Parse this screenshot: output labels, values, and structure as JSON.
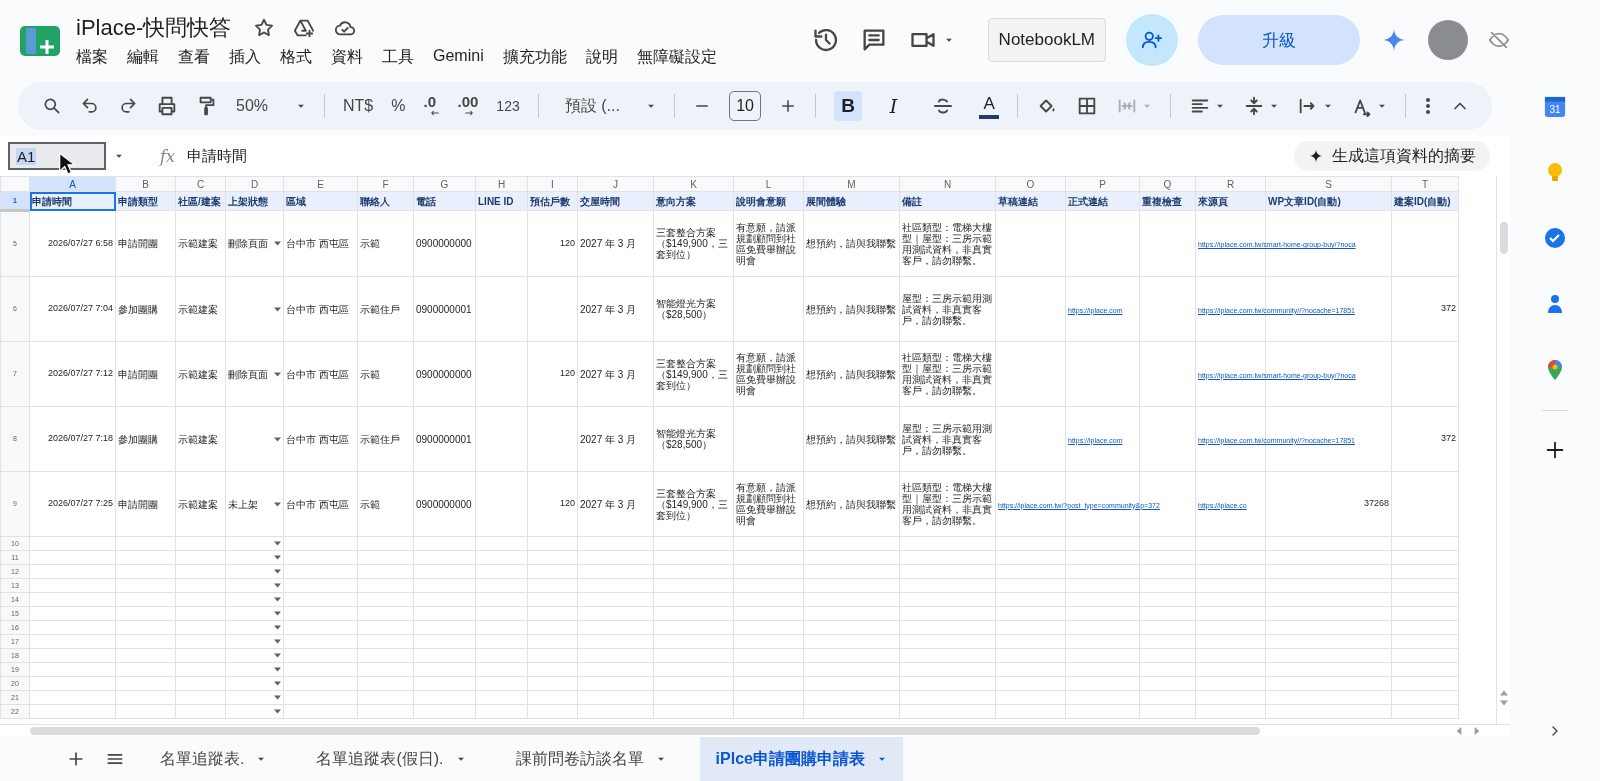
{
  "app": {
    "title": "iPlace-快問快答",
    "menu": [
      "檔案",
      "編輯",
      "查看",
      "插入",
      "格式",
      "資料",
      "工具",
      "Gemini",
      "擴充功能",
      "說明",
      "無障礙設定"
    ]
  },
  "header_buttons": {
    "notebook": "NotebookLM",
    "upgrade": "升級"
  },
  "toolbar": {
    "zoom": "50%",
    "currency": "NT$",
    "percent": "%",
    "decrease_decimals": ".0",
    "increase_decimals": ".00",
    "number_format": "123",
    "font": "預設 (...",
    "font_size": "10",
    "text_styles": [
      {
        "kind": "bold",
        "label": "B",
        "selected": true
      },
      {
        "kind": "italic",
        "label": "I",
        "selected": false
      },
      {
        "kind": "strikethrough",
        "selected": false
      },
      {
        "kind": "text_color",
        "label": "A",
        "selected": false
      }
    ],
    "merge": {
      "disabled": true
    }
  },
  "formula_bar": {
    "cell_ref": "A1",
    "fx": "fx",
    "value": "申請時間",
    "summary_button": "生成這項資料的摘要"
  },
  "sheet": {
    "columns": [
      {
        "letter": "A",
        "selected": true
      },
      {
        "letter": "B",
        "selected": false
      },
      {
        "letter": "C",
        "selected": false
      },
      {
        "letter": "D",
        "selected": false
      },
      {
        "letter": "E",
        "selected": false
      },
      {
        "letter": "F",
        "selected": false
      },
      {
        "letter": "G",
        "selected": false
      },
      {
        "letter": "H",
        "selected": false
      },
      {
        "letter": "I",
        "selected": false
      },
      {
        "letter": "J",
        "selected": false
      },
      {
        "letter": "K",
        "selected": false
      },
      {
        "letter": "L",
        "selected": false
      },
      {
        "letter": "M",
        "selected": false
      },
      {
        "letter": "N",
        "selected": false
      },
      {
        "letter": "O",
        "selected": false
      },
      {
        "letter": "P",
        "selected": false
      },
      {
        "letter": "Q",
        "selected": false
      },
      {
        "letter": "R",
        "selected": false
      },
      {
        "letter": "S",
        "selected": false
      },
      {
        "letter": "T",
        "selected": false
      }
    ],
    "rows": [
      {
        "number": "1",
        "selected": true,
        "kind": "header",
        "cells": [
          "申請時間",
          "申請類型",
          "社區/建案",
          "上架狀態",
          "區域",
          "聯絡人",
          "電話",
          "LINE ID",
          "預估戶數",
          "交屋時間",
          "意向方案",
          "說明會意願",
          "展間體驗",
          "備註",
          "草稿連結",
          "正式連結",
          "重複檢查",
          "來源頁",
          "WP文章ID(自動)",
          "建案ID(自動)"
        ]
      },
      {
        "number": "5",
        "selected": false,
        "kind": "data",
        "cells": [
          {
            "kind": "number",
            "text": "2026/07/27 6:58"
          },
          "申請開團",
          "示範建案",
          {
            "kind": "dropdown",
            "text": "刪除頁面"
          },
          "台中市 西屯區",
          "示範",
          "0900000000",
          null,
          {
            "kind": "number",
            "text": "120"
          },
          "2027 年 3 月",
          "三套整合方案（$149,900，三套到位）",
          "有意願，請派規劃顧問到社區免費舉辦說明會",
          "想預約，請與我聯繫",
          "社區類型：電梯大樓型｜屋型：三房示範用測試資料，非真實客戶，請勿聯繫。",
          null,
          null,
          null,
          {
            "kind": "link",
            "text": "https://iplace.com.tw/smart-home-group-buy/?noca"
          },
          null,
          null
        ]
      },
      {
        "number": "6",
        "selected": false,
        "kind": "data",
        "cells": [
          {
            "kind": "number",
            "text": "2026/07/27 7:04"
          },
          "參加團購",
          "示範建案",
          {
            "kind": "dropdown"
          },
          "台中市 西屯區",
          "示範住戶",
          "0900000001",
          null,
          null,
          "2027 年 3 月",
          "智能燈光方案（$28,500）",
          null,
          "想預約，請與我聯繫",
          "屋型：三房示範用測試資料，非真實客戶，請勿聯繫。",
          null,
          {
            "kind": "link",
            "text": "https://iplace.com"
          },
          null,
          {
            "kind": "link",
            "text": "https://iplace.com.tw/community//?nocache=17851"
          },
          null,
          {
            "kind": "number",
            "text": "372"
          }
        ]
      },
      {
        "number": "7",
        "selected": false,
        "kind": "data",
        "cells": [
          {
            "kind": "number",
            "text": "2026/07/27 7:12"
          },
          "申請開團",
          "示範建案",
          {
            "kind": "dropdown",
            "text": "刪除頁面"
          },
          "台中市 西屯區",
          "示範",
          "0900000000",
          null,
          {
            "kind": "number",
            "text": "120"
          },
          "2027 年 3 月",
          "三套整合方案（$149,900，三套到位）",
          "有意願，請派規劃顧問到社區免費舉辦說明會",
          "想預約，請與我聯繫",
          "社區類型：電梯大樓型｜屋型：三房示範用測試資料，非真實客戶，請勿聯繫。",
          null,
          null,
          null,
          {
            "kind": "link",
            "text": "https://iplace.com.tw/smart-home-group-buy/?noca"
          },
          null,
          null
        ]
      },
      {
        "number": "8",
        "selected": false,
        "kind": "data",
        "cells": [
          {
            "kind": "number",
            "text": "2026/07/27 7:18"
          },
          "參加團購",
          "示範建案",
          {
            "kind": "dropdown"
          },
          "台中市 西屯區",
          "示範住戶",
          "0900000001",
          null,
          null,
          "2027 年 3 月",
          "智能燈光方案（$28,500）",
          null,
          "想預約，請與我聯繫",
          "屋型：三房示範用測試資料，非真實客戶，請勿聯繫。",
          null,
          {
            "kind": "link",
            "text": "https://iplace.com"
          },
          null,
          {
            "kind": "link",
            "text": "https://iplace.com.tw/community//?nocache=17851"
          },
          null,
          {
            "kind": "number",
            "text": "372"
          }
        ]
      },
      {
        "number": "9",
        "selected": false,
        "kind": "data",
        "cells": [
          {
            "kind": "number",
            "text": "2026/07/27 7:25"
          },
          "申請開團",
          "示範建案",
          {
            "kind": "dropdown",
            "text": "未上架"
          },
          "台中市 西屯區",
          "示範",
          "0900000000",
          null,
          {
            "kind": "number",
            "text": "120"
          },
          "2027 年 3 月",
          "三套整合方案（$149,900，三套到位）",
          "有意願，請派規劃顧問到社區免費舉辦說明會",
          "想預約，請與我聯繫",
          "社區類型：電梯大樓型｜屋型：三房示範用測試資料，非真實客戶，請勿聯繫。",
          {
            "kind": "link",
            "text": "https://iplace.com.tw/?post_type=community&p=372"
          },
          null,
          null,
          {
            "kind": "link",
            "text": "https://iplace.co"
          },
          {
            "kind": "number",
            "text": "37268"
          },
          null
        ]
      },
      {
        "number": "10",
        "selected": false,
        "kind": "blank",
        "cells": [
          null,
          null,
          null,
          {
            "kind": "dropdown"
          }
        ]
      },
      {
        "number": "11",
        "selected": false,
        "kind": "blank",
        "cells": [
          null,
          null,
          null,
          {
            "kind": "dropdown"
          }
        ]
      },
      {
        "number": "12",
        "selected": false,
        "kind": "blank",
        "cells": [
          null,
          null,
          null,
          {
            "kind": "dropdown"
          }
        ]
      },
      {
        "number": "13",
        "selected": false,
        "kind": "blank",
        "cells": [
          null,
          null,
          null,
          {
            "kind": "dropdown"
          }
        ]
      },
      {
        "number": "14",
        "selected": false,
        "kind": "blank",
        "cells": [
          null,
          null,
          null,
          {
            "kind": "dropdown"
          }
        ]
      },
      {
        "number": "15",
        "selected": false,
        "kind": "blank",
        "cells": [
          null,
          null,
          null,
          {
            "kind": "dropdown"
          }
        ]
      },
      {
        "number": "16",
        "selected": false,
        "kind": "blank",
        "cells": [
          null,
          null,
          null,
          {
            "kind": "dropdown"
          }
        ]
      },
      {
        "number": "17",
        "selected": false,
        "kind": "blank",
        "cells": [
          null,
          null,
          null,
          {
            "kind": "dropdown"
          }
        ]
      },
      {
        "number": "18",
        "selected": false,
        "kind": "blank",
        "cells": [
          null,
          null,
          null,
          {
            "kind": "dropdown"
          }
        ]
      },
      {
        "number": "19",
        "selected": false,
        "kind": "blank",
        "cells": [
          null,
          null,
          null,
          {
            "kind": "dropdown"
          }
        ]
      },
      {
        "number": "20",
        "selected": false,
        "kind": "blank",
        "cells": [
          null,
          null,
          null,
          {
            "kind": "dropdown"
          }
        ]
      },
      {
        "number": "21",
        "selected": false,
        "kind": "blank",
        "cells": [
          null,
          null,
          null,
          {
            "kind": "dropdown"
          }
        ]
      },
      {
        "number": "22",
        "selected": false,
        "kind": "blank",
        "cells": [
          null,
          null,
          null,
          {
            "kind": "dropdown"
          }
        ]
      }
    ]
  },
  "sheet_tabs": [
    {
      "label": "名單追蹤表.",
      "selected": false
    },
    {
      "label": "名單追蹤表(假日).",
      "selected": false
    },
    {
      "label": "課前問卷訪談名單",
      "selected": false
    },
    {
      "label": "iPlce申請團購申請表",
      "selected": true
    }
  ],
  "side_panel": {
    "items": [
      {
        "kind": "calendar",
        "label": "31"
      },
      {
        "kind": "keep"
      },
      {
        "kind": "tasks"
      },
      {
        "kind": "contacts"
      },
      {
        "kind": "maps"
      },
      {
        "kind": "add"
      }
    ]
  }
}
